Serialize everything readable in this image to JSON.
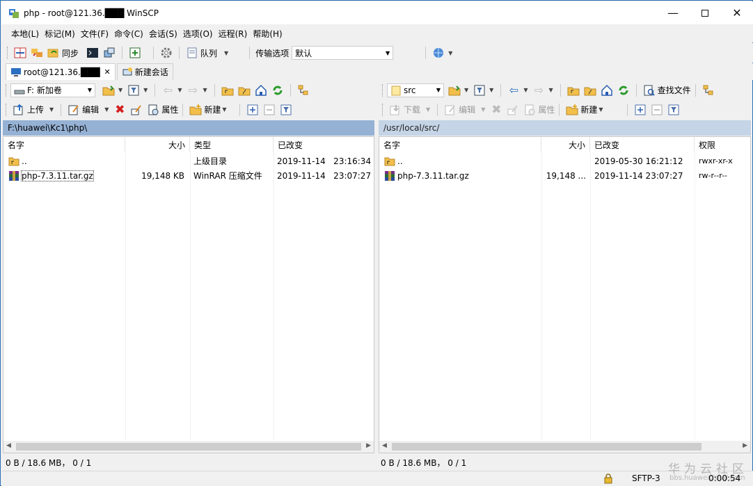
{
  "window": {
    "title": "php - root@121.36.███ WinSCP"
  },
  "menu": [
    "本地(L)",
    "标记(M)",
    "文件(F)",
    "命令(C)",
    "会话(S)",
    "选项(O)",
    "远程(R)",
    "帮助(H)"
  ],
  "toolbar": {
    "sync_label": "同步",
    "queue_label": "队列",
    "transfer_label": "传输选项",
    "transfer_value": "默认"
  },
  "tabs": {
    "session": "root@121.36.███",
    "new_session": "新建会话"
  },
  "local": {
    "drive": "F: 新加卷",
    "actions": {
      "upload": "上传",
      "edit": "编辑",
      "properties": "属性",
      "new": "新建"
    },
    "path": "F:\\huawei\\Kc1\\php\\",
    "columns": {
      "name": "名字",
      "size": "大小",
      "type": "类型",
      "changed": "已改变"
    },
    "rows": [
      {
        "name": "..",
        "size": "",
        "type": "上级目录",
        "changed": "2019-11-14   23:16:34"
      },
      {
        "name": "php-7.3.11.tar.gz",
        "size": "19,148 KB",
        "type": "WinRAR 压缩文件",
        "changed": "2019-11-14   23:07:27"
      }
    ],
    "status": "0 B / 18.6 MB，  0 / 1"
  },
  "remote": {
    "dir": "src",
    "actions": {
      "download": "下载",
      "edit": "编辑",
      "properties": "属性",
      "new": "新建",
      "find": "查找文件"
    },
    "path": "/usr/local/src/",
    "columns": {
      "name": "名字",
      "size": "大小",
      "changed": "已改变",
      "rights": "权限"
    },
    "rows": [
      {
        "name": "..",
        "size": "",
        "changed": "2019-05-30 16:21:12",
        "rights": "rwxr-xr-x"
      },
      {
        "name": "php-7.3.11.tar.gz",
        "size": "19,148 ...",
        "changed": "2019-11-14 23:07:27",
        "rights": "rw-r--r--"
      }
    ],
    "status": "0 B / 18.6 MB，  0 / 1"
  },
  "statusbar": {
    "protocol": "SFTP-3",
    "time": "0:00:54",
    "watermark": "华为云社区",
    "watermark_url": "bbs.huaweicloud.com"
  },
  "colors": {
    "local_path_bg": "#95b1d4",
    "remote_path_bg": "#c5d4e6",
    "frame": "#2b6fb5"
  }
}
